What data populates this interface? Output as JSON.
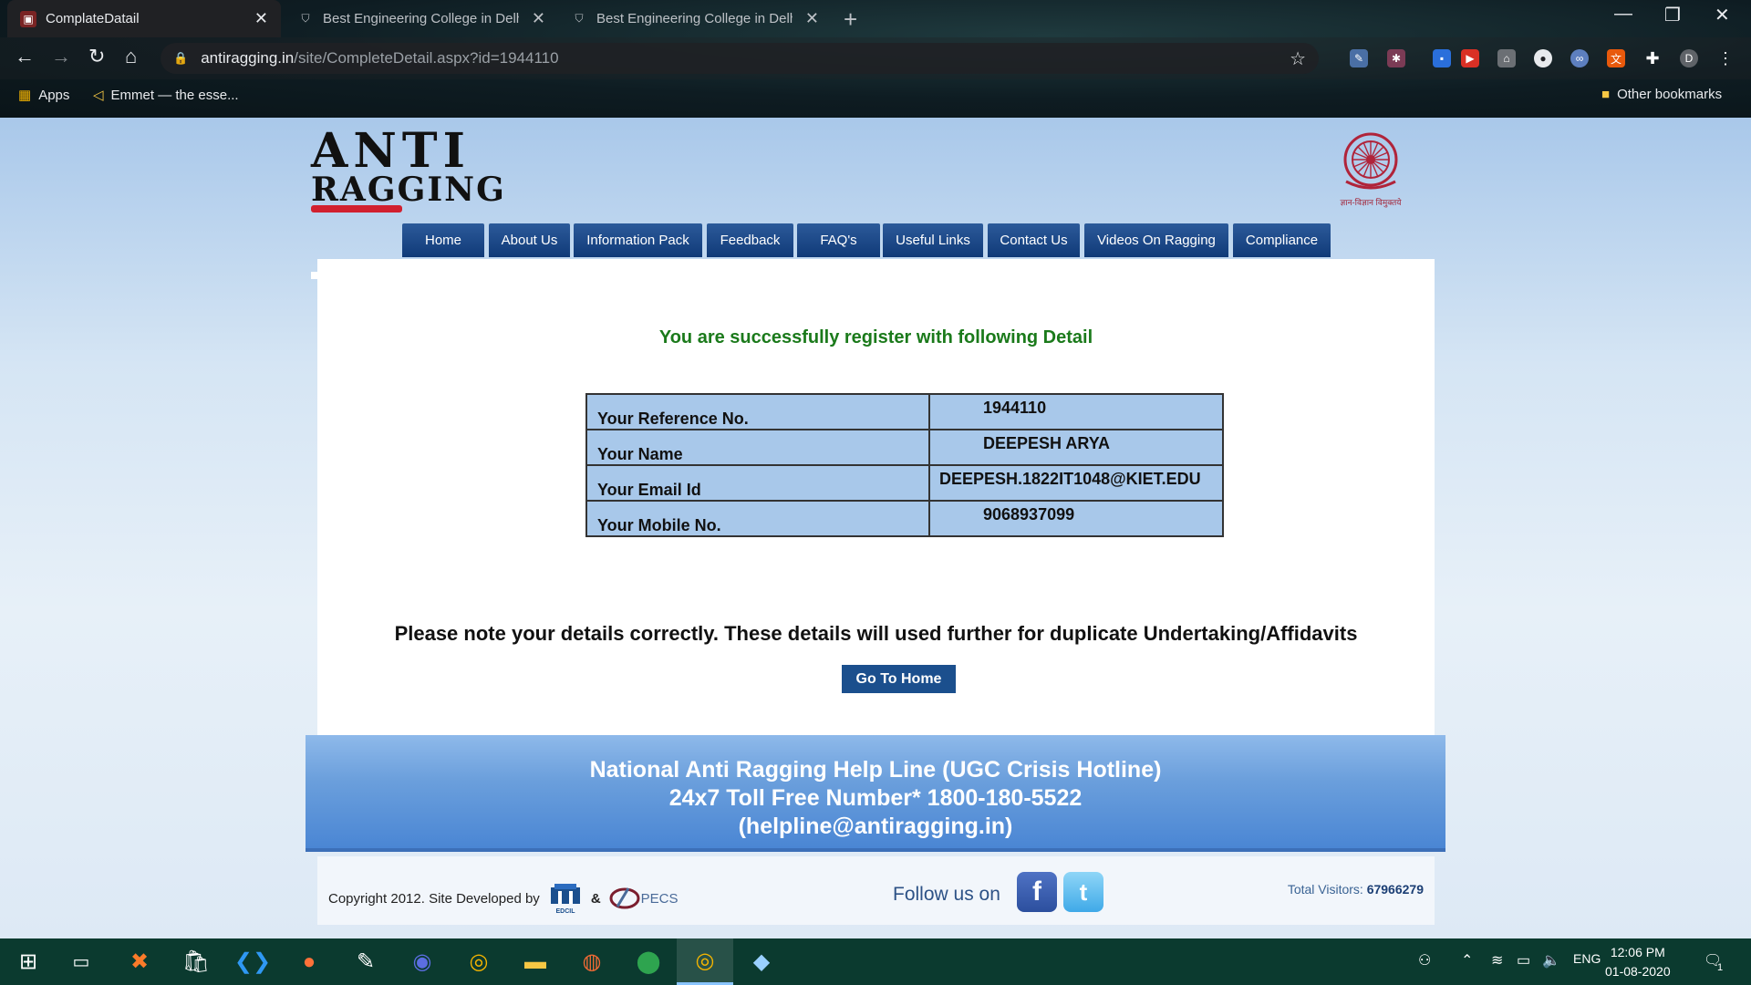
{
  "browser": {
    "tabs": [
      {
        "title": "ComplateDatail",
        "active": true
      },
      {
        "title": "Best Engineering College in Delh",
        "active": false
      },
      {
        "title": "Best Engineering College in Delh",
        "active": false
      }
    ],
    "url_host": "antiragging.in",
    "url_path": "/site/CompleteDetail.aspx?id=1944110",
    "bookmarks": [
      {
        "label": "Apps",
        "icon": "apps-grid-icon"
      },
      {
        "label": "Emmet — the esse...",
        "icon": "emmet-icon"
      }
    ],
    "other_bookmarks": "Other bookmarks",
    "profile_initial": "D"
  },
  "site": {
    "logo_line1": "ANTI",
    "logo_line2": "RAGGING",
    "ugc_motto": "ज्ञान-विज्ञान विमुक्तये",
    "nav": [
      "Home",
      "About Us",
      "Information Pack",
      "Feedback",
      "FAQ's",
      "Useful Links",
      "Contact Us",
      "Videos On Ragging",
      "Compliance"
    ]
  },
  "main": {
    "success_message": "You are successfully register with following Detail",
    "details": [
      {
        "label": "Your Reference No.",
        "value": "1944110"
      },
      {
        "label": "Your Name",
        "value": "DEEPESH ARYA"
      },
      {
        "label": "Your Email Id",
        "value": "DEEPESH.1822IT1048@KIET.EDU"
      },
      {
        "label": "Your Mobile No.",
        "value": "9068937099"
      }
    ],
    "note": "Please note your details correctly. These details will used further for duplicate Undertaking/Affidavits",
    "go_home_label": "Go To Home"
  },
  "helpline": {
    "line1": "National Anti Ragging Help Line (UGC Crisis Hotline)",
    "line2": "24x7 Toll Free Number* 1800-180-5522",
    "line3": "(helpline@antiragging.in)"
  },
  "footer": {
    "copyright": "Copyright 2012. Site Developed by",
    "edcil_label": "EDCIL",
    "amp": "&",
    "pecs_label": "PECS",
    "follow_us": "Follow us on",
    "visitors_label": "Total Visitors:",
    "visitors_count": "67966279"
  },
  "taskbar": {
    "language": "ENG",
    "time": "12:06 PM",
    "date": "01-08-2020",
    "notification_count": "1"
  },
  "colors": {
    "nav_bg": "#1b4a8a",
    "success_green": "#1b7a1b",
    "table_bg": "#a8c8ea",
    "helpline_blue": "#5b93d8",
    "taskbar_bg": "#0b3a2f"
  }
}
